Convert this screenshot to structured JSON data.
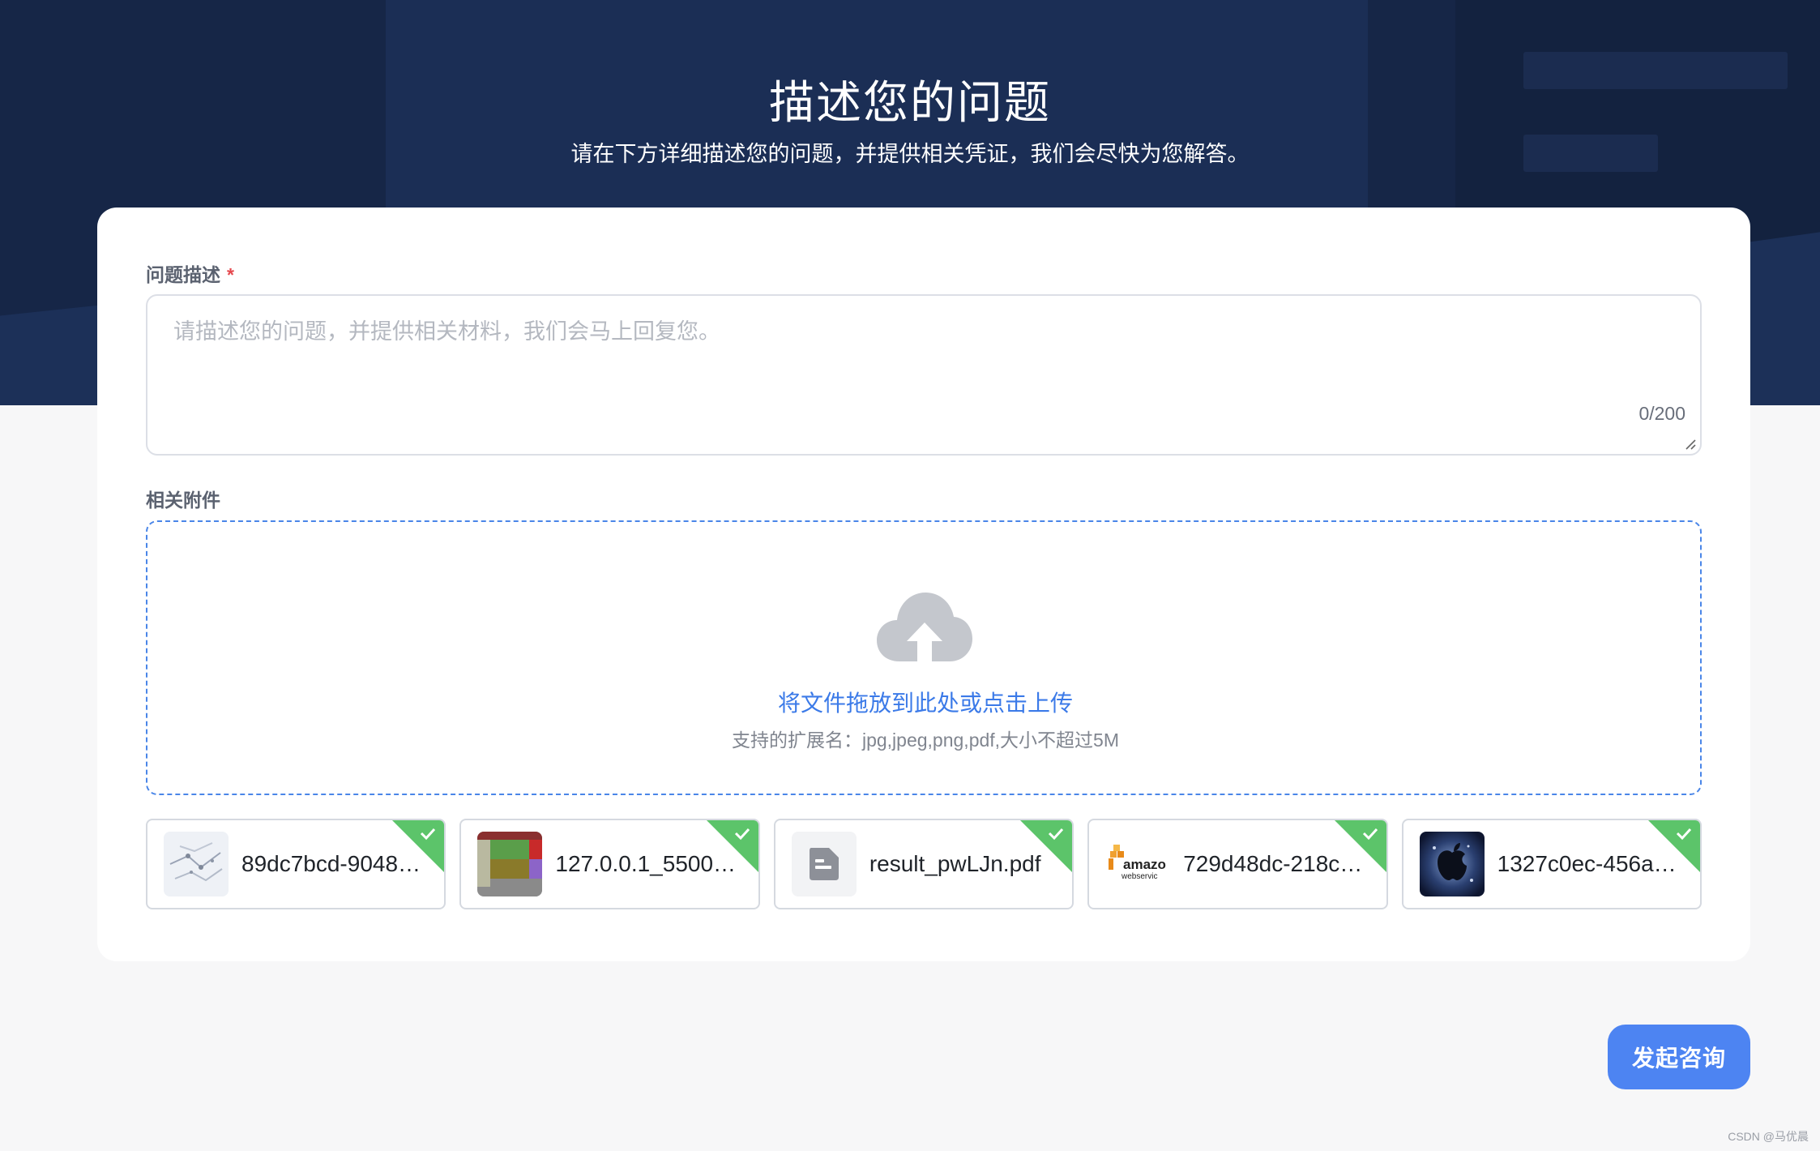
{
  "header": {
    "title": "描述您的问题",
    "subtitle": "请在下方详细描述您的问题，并提供相关凭证，我们会尽快为您解答。"
  },
  "form": {
    "description": {
      "label": "问题描述",
      "required_mark": "*",
      "placeholder": "请描述您的问题，并提供相关材料，我们会马上回复您。",
      "value": "",
      "counter": "0/200"
    },
    "attachments": {
      "label": "相关附件",
      "upload_icon": "cloud-upload-icon",
      "upload_text": "将文件拖放到此处或点击上传",
      "upload_hint": "支持的扩展名：jpg,jpeg,png,pdf,大小不超过5M",
      "files": [
        {
          "name": "89dc7bcd-9048…",
          "thumb": "map-thumbnail",
          "status": "success"
        },
        {
          "name": "127.0.0.1_5500…",
          "thumb": "color-blocks-thumbnail",
          "status": "success"
        },
        {
          "name": "result_pwLJn.pdf",
          "thumb": "document-icon",
          "status": "success"
        },
        {
          "name": "729d48dc-218c…",
          "thumb": "amazon-web-services-logo",
          "status": "success"
        },
        {
          "name": "1327c0ec-456a…",
          "thumb": "apple-logo-thumbnail",
          "status": "success"
        }
      ]
    }
  },
  "actions": {
    "submit_label": "发起咨询"
  },
  "watermark": "CSDN @马优晨",
  "colors": {
    "hero_bg": "#162647",
    "accent": "#4d84f2",
    "link": "#3b7ae8",
    "success": "#5cc46a",
    "required": "#e5484d",
    "dashed_border": "#4a86e8"
  }
}
